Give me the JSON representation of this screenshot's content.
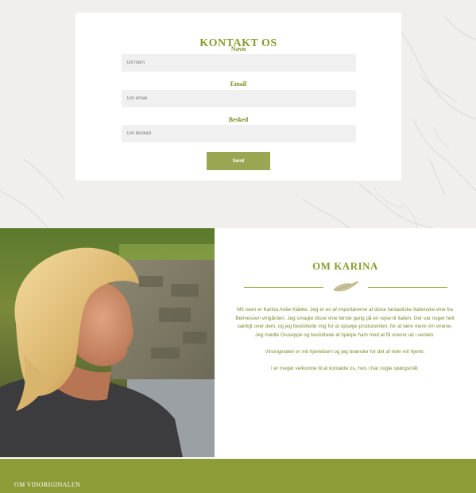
{
  "contact": {
    "title": "KONTAKT OS",
    "name_label": "Navn",
    "name_placeholder": "Dit navn",
    "email_label": "Email",
    "email_placeholder": "Din email",
    "message_label": "Besked",
    "message_placeholder": "Din besked",
    "send_label": "Send"
  },
  "about": {
    "title": "OM KARINA",
    "paragraph1": "Mit navn er Karina Anée Købke. Jeg er en af importørerne af disse fantastiske Italienske vine fra Belmesseri vingården. Jeg smagte disse vine første gang på en rejse til Italien. Der var noget helt særligt over dem, og jeg besluttede mig for at opsøge producenten, for at lære mere om vinene. Jeg mødte Giuseppe og besluttede at hjælpe ham med at få vinene ud i verden.",
    "paragraph2": "Vinoriginalen er mit hjertebarn og jeg brænder for det af hele mit hjerte.",
    "paragraph3": "I er meget velkomne til at kontakte os, hvis I har nogle spørgsmål."
  },
  "footer": {
    "title": "OM VINORIGINALEN"
  },
  "colors": {
    "accent": "#8a9a2d",
    "button": "#9aa651",
    "footer": "#8e9c38"
  }
}
